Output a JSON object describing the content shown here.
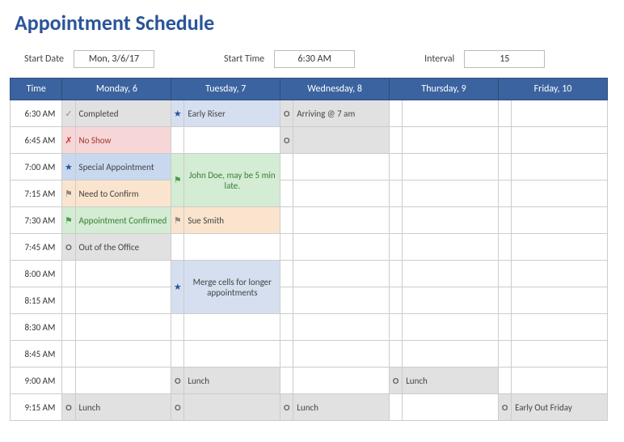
{
  "title": "Appointment Schedule",
  "controls": {
    "start_date_label": "Start Date",
    "start_date_value": "Mon, 3/6/17",
    "start_time_label": "Start Time",
    "start_time_value": "6:30 AM",
    "interval_label": "Interval",
    "interval_value": "15"
  },
  "headers": {
    "time": "Time",
    "d1": "Monday, 6",
    "d2": "Tuesday, 7",
    "d3": "Wednesday, 8",
    "d4": "Thursday, 9",
    "d5": "Friday, 10"
  },
  "times": {
    "t0": "6:30 AM",
    "t1": "6:45 AM",
    "t2": "7:00 AM",
    "t3": "7:15 AM",
    "t4": "7:30 AM",
    "t5": "7:45 AM",
    "t6": "8:00 AM",
    "t7": "8:15 AM",
    "t8": "8:30 AM",
    "t9": "8:45 AM",
    "t10": "9:00 AM",
    "t11": "9:15 AM"
  },
  "cells": {
    "mon": {
      "r0": "Completed",
      "r1": "No Show",
      "r2": "Special Appointment",
      "r3": "Need to Confirm",
      "r4": "Appointment Confirmed",
      "r5": "Out of the Office",
      "r11": "Lunch"
    },
    "tue": {
      "r0": "Early Riser",
      "r2": "John Doe, may be 5 min late.",
      "r4": "Sue Smith",
      "r6": "Merge cells for longer appointments",
      "r10": "Lunch"
    },
    "wed": {
      "r0": "Arriving @ 7 am",
      "r11": "Lunch"
    },
    "thu": {
      "r10": "Lunch"
    },
    "fri": {
      "r11": "Early Out Friday"
    }
  },
  "icons": {
    "check": "✓",
    "cross": "✗",
    "star": "★",
    "flag": "⚑",
    "circle": "O"
  }
}
